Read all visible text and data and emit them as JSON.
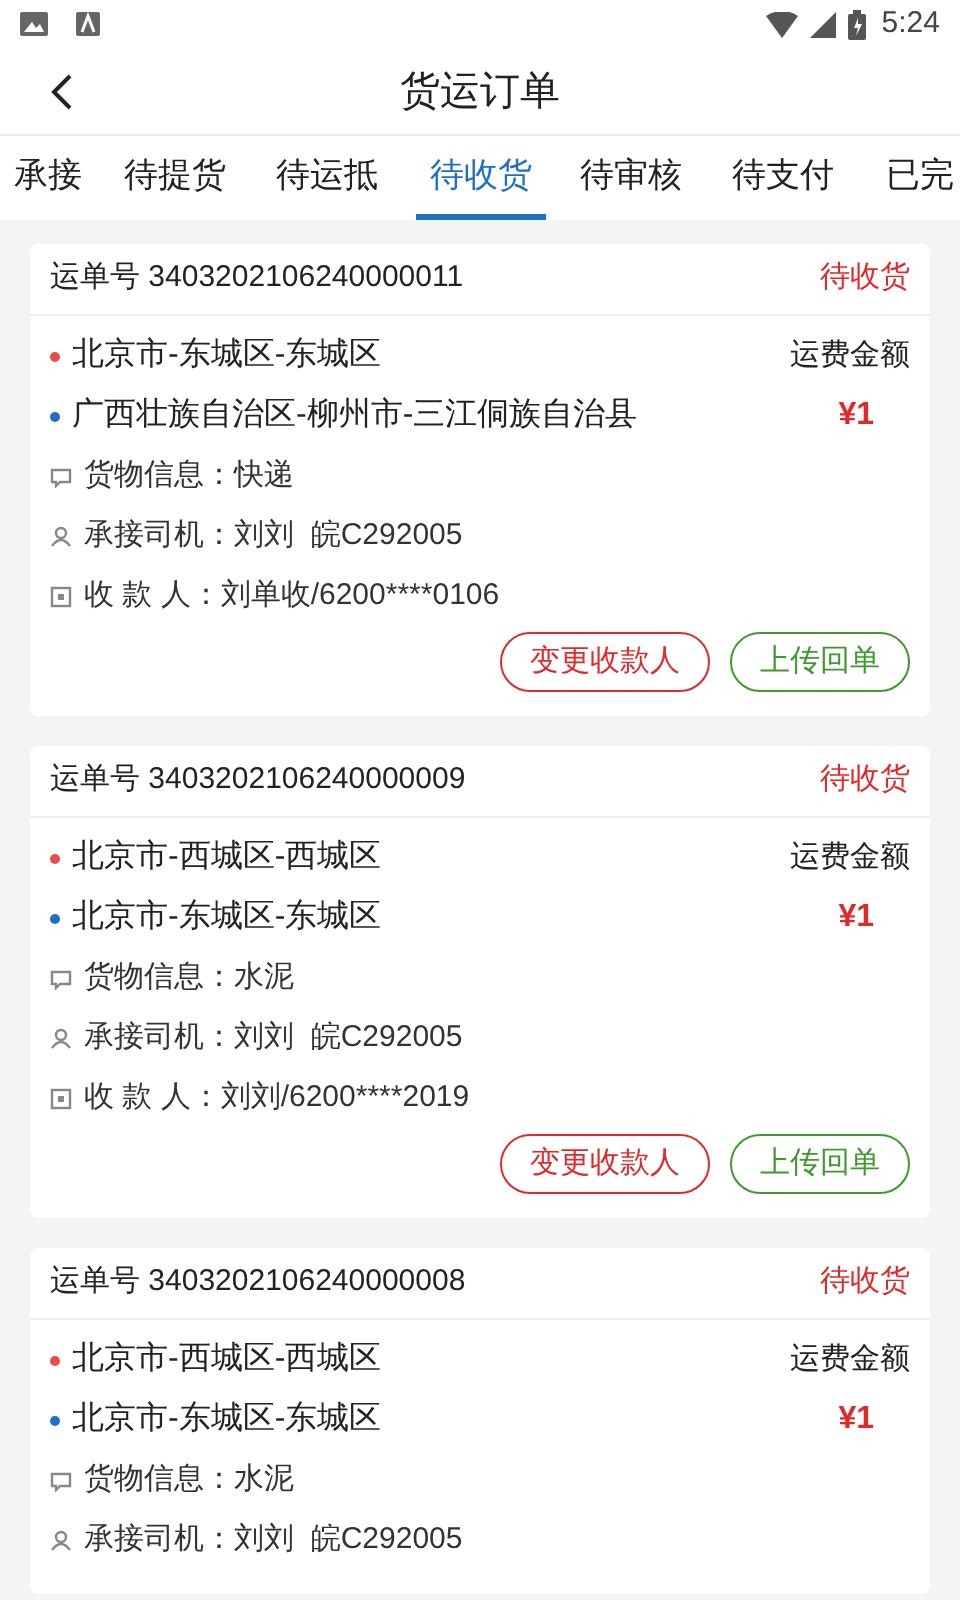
{
  "status_bar": {
    "time": "5:24"
  },
  "header": {
    "title": "货运订单"
  },
  "tabs": [
    {
      "label": "承接",
      "selected": false
    },
    {
      "label": "待提货",
      "selected": false
    },
    {
      "label": "待运抵",
      "selected": false
    },
    {
      "label": "待收货",
      "selected": true
    },
    {
      "label": "待审核",
      "selected": false
    },
    {
      "label": "待支付",
      "selected": false
    },
    {
      "label": "已完",
      "selected": false
    }
  ],
  "orders": [
    {
      "order_no": "运单号 3403202106240000011",
      "status": "待收货",
      "stops": [
        {
          "name": "北京市-东城区-东城区",
          "color": "#e94b4b"
        },
        {
          "name": "广西壮族自治区-柳州市-三江侗族自治县",
          "color": "#1f6fc6"
        }
      ],
      "fee_label": "运费金额",
      "fee": "¥1",
      "details": [
        {
          "kind": "cargo",
          "text": "货物信息：快递"
        },
        {
          "kind": "driver",
          "text": "承接司机：刘刘  皖C292005"
        },
        {
          "kind": "payee",
          "text": "收 款 人：刘单收/6200****0106"
        }
      ],
      "buttons": [
        {
          "label": "变更收款人",
          "kind": "danger"
        },
        {
          "label": "上传回单",
          "kind": "success"
        }
      ]
    },
    {
      "order_no": "运单号 3403202106240000009",
      "status": "待收货",
      "stops": [
        {
          "name": "北京市-西城区-西城区",
          "color": "#e94b4b"
        },
        {
          "name": "北京市-东城区-东城区",
          "color": "#1f6fc6"
        }
      ],
      "fee_label": "运费金额",
      "fee": "¥1",
      "details": [
        {
          "kind": "cargo",
          "text": "货物信息：水泥"
        },
        {
          "kind": "driver",
          "text": "承接司机：刘刘  皖C292005"
        },
        {
          "kind": "payee",
          "text": "收 款 人：刘刘/6200****2019"
        }
      ],
      "buttons": [
        {
          "label": "变更收款人",
          "kind": "danger"
        },
        {
          "label": "上传回单",
          "kind": "success"
        }
      ]
    },
    {
      "order_no": "运单号 3403202106240000008",
      "status": "待收货",
      "stops": [
        {
          "name": "北京市-西城区-西城区",
          "color": "#e94b4b"
        },
        {
          "name": "北京市-东城区-东城区",
          "color": "#1f6fc6"
        }
      ],
      "fee_label": "运费金额",
      "fee": "¥1",
      "details": [
        {
          "kind": "cargo",
          "text": "货物信息：水泥"
        },
        {
          "kind": "driver",
          "text": "承接司机：刘刘  皖C292005"
        }
      ]
    }
  ]
}
